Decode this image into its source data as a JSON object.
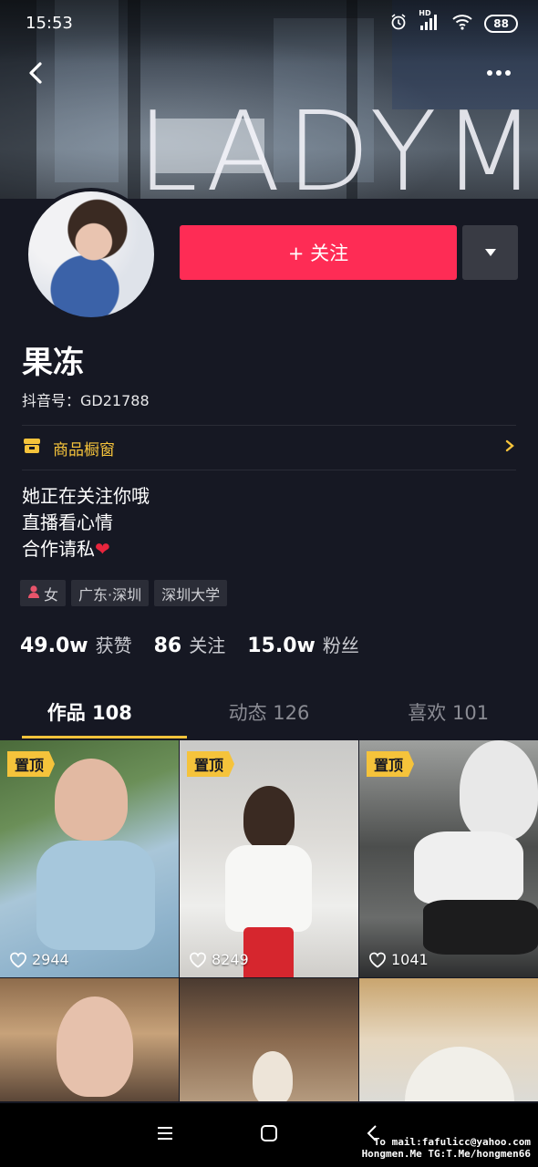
{
  "status_bar": {
    "time": "15:53",
    "network": "HD",
    "battery": "88"
  },
  "cover": {
    "brand_text": "LADYM"
  },
  "header": {
    "back_icon": "chevron-left-icon",
    "more_icon": "more-dots-icon"
  },
  "profile": {
    "name": "果冻",
    "douyin_id": "抖音号：GD21788",
    "follow_label": "+ 关注",
    "shop_label": "商品橱窗",
    "bio": [
      "她正在关注你哦",
      "直播看心情",
      "合作请私"
    ],
    "tags": [
      "女",
      "广东·深圳",
      "深圳大学"
    ]
  },
  "stats": [
    {
      "value": "49.0w",
      "label": "获赞"
    },
    {
      "value": "86",
      "label": "关注"
    },
    {
      "value": "15.0w",
      "label": "粉丝"
    }
  ],
  "tabs": [
    {
      "label": "作品 108",
      "active": true
    },
    {
      "label": "动态 126",
      "active": false
    },
    {
      "label": "喜欢 101",
      "active": false
    }
  ],
  "videos": [
    {
      "pinned_label": "置顶",
      "likes": "2944"
    },
    {
      "pinned_label": "置顶",
      "likes": "8249"
    },
    {
      "pinned_label": "置顶",
      "likes": "1041"
    }
  ],
  "watermark": {
    "line1": "To mail:fafulicc@yahoo.com",
    "line2": "Hongmen.Me TG:T.Me/hongmen66"
  },
  "colors": {
    "background": "#161823",
    "accent": "#fe2c55",
    "highlight": "#f5c33b"
  }
}
